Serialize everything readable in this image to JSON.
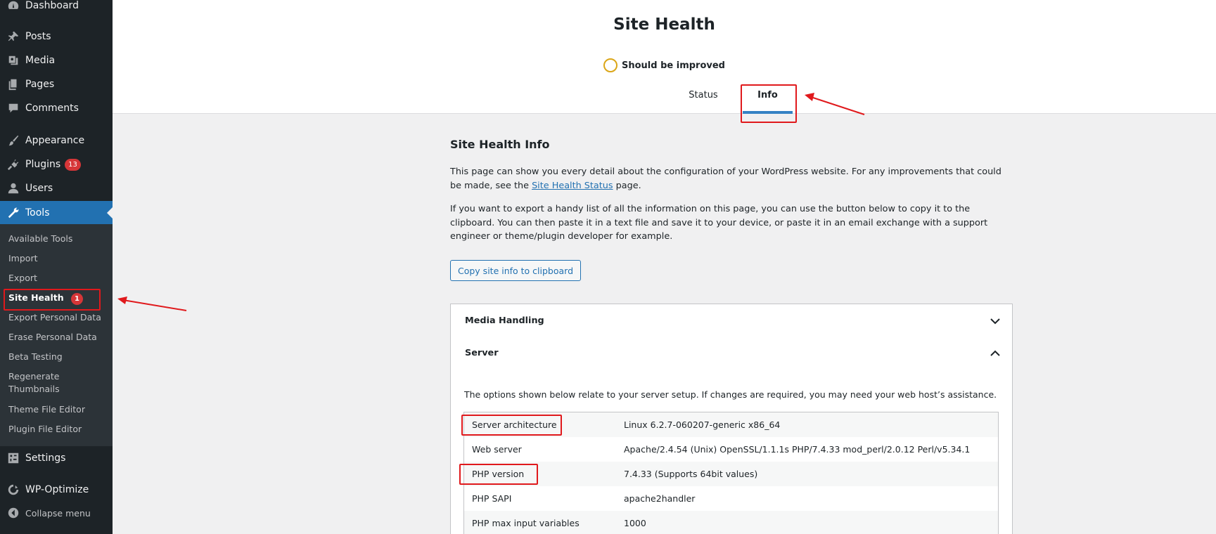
{
  "sidebar": {
    "items": [
      {
        "label": "Dashboard",
        "icon": "dashboard-icon"
      },
      {
        "label": "Posts",
        "icon": "pin-icon"
      },
      {
        "label": "Media",
        "icon": "media-icon"
      },
      {
        "label": "Pages",
        "icon": "pages-icon"
      },
      {
        "label": "Comments",
        "icon": "comment-icon"
      },
      {
        "label": "Appearance",
        "icon": "brush-icon"
      },
      {
        "label": "Plugins",
        "icon": "plugin-icon",
        "badge": "13"
      },
      {
        "label": "Users",
        "icon": "user-icon"
      },
      {
        "label": "Tools",
        "icon": "wrench-icon"
      },
      {
        "label": "Settings",
        "icon": "settings-icon"
      },
      {
        "label": "WP-Optimize",
        "icon": "optimize-icon"
      }
    ],
    "submenu": [
      {
        "label": "Available Tools"
      },
      {
        "label": "Import"
      },
      {
        "label": "Export"
      },
      {
        "label": "Site Health",
        "badge": "1"
      },
      {
        "label": "Export Personal Data"
      },
      {
        "label": "Erase Personal Data"
      },
      {
        "label": "Beta Testing"
      },
      {
        "label": "Regenerate Thumbnails"
      },
      {
        "label": "Theme File Editor"
      },
      {
        "label": "Plugin File Editor"
      }
    ],
    "collapse_label": "Collapse menu"
  },
  "header": {
    "title": "Site Health",
    "status": "Should be improved",
    "tabs": [
      {
        "label": "Status"
      },
      {
        "label": "Info"
      }
    ]
  },
  "main": {
    "heading": "Site Health Info",
    "para1_before": "This page can show you every detail about the configuration of your WordPress website. For any improvements that could be made, see the ",
    "para1_link": "Site Health Status",
    "para1_after": " page.",
    "para2": "If you want to export a handy list of all the information on this page, you can use the button below to copy it to the clipboard. You can then paste it in a text file and save it to your device, or paste it in an email exchange with a support engineer or theme/plugin developer for example.",
    "copy_button": "Copy site info to clipboard",
    "sections": [
      {
        "label": "Media Handling"
      },
      {
        "label": "Server"
      }
    ],
    "server_description": "The options shown below relate to your server setup. If changes are required, you may need your web host’s assistance.",
    "server_rows": [
      {
        "key": "Server architecture",
        "value": "Linux 6.2.7-060207-generic x86_64"
      },
      {
        "key": "Web server",
        "value": "Apache/2.4.54 (Unix) OpenSSL/1.1.1s PHP/7.4.33 mod_perl/2.0.12 Perl/v5.34.1"
      },
      {
        "key": "PHP version",
        "value": "7.4.33 (Supports 64bit values)"
      },
      {
        "key": "PHP SAPI",
        "value": "apache2handler"
      },
      {
        "key": "PHP max input variables",
        "value": "1000"
      }
    ]
  },
  "colors": {
    "sidebar_bg": "#1d2327",
    "submenu_bg": "#2c3338",
    "accent": "#2271b1",
    "badge": "#d63638",
    "status_ring": "#dba617",
    "annotation": "#e0191c"
  }
}
